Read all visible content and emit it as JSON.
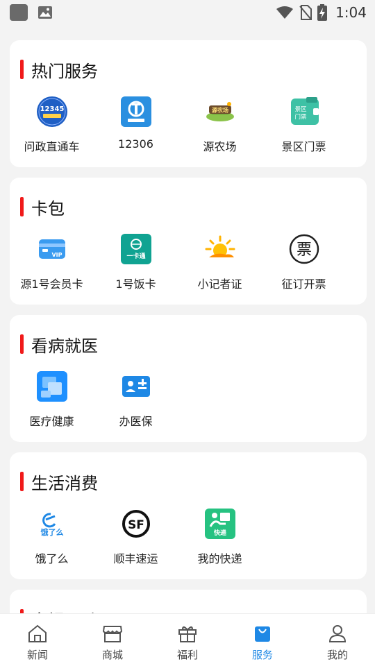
{
  "status_bar": {
    "time": "1:04"
  },
  "sections": [
    {
      "title": "热门服务",
      "items": [
        {
          "label": "问政直通车",
          "icon": "12345-hotline-icon",
          "badge": "12345"
        },
        {
          "label": "12306",
          "icon": "railway-12306-icon"
        },
        {
          "label": "源农场",
          "icon": "farm-icon",
          "badge": "源农场"
        },
        {
          "label": "景区门票",
          "icon": "scenic-ticket-icon",
          "badge": "景区门票"
        }
      ]
    },
    {
      "title": "卡包",
      "items": [
        {
          "label": "源1号会员卡",
          "icon": "vip-card-icon",
          "badge": "VIP"
        },
        {
          "label": "1号饭卡",
          "icon": "meal-card-icon",
          "badge": "一卡通"
        },
        {
          "label": "小记者证",
          "icon": "sun-icon"
        },
        {
          "label": "征订开票",
          "icon": "invoice-icon",
          "badge": "票"
        }
      ]
    },
    {
      "title": "看病就医",
      "items": [
        {
          "label": "医疗健康",
          "icon": "medical-health-icon"
        },
        {
          "label": "办医保",
          "icon": "medical-insurance-icon"
        }
      ]
    },
    {
      "title": "生活消费",
      "items": [
        {
          "label": "饿了么",
          "icon": "eleme-icon",
          "badge": "饿了么"
        },
        {
          "label": "顺丰速运",
          "icon": "sf-express-icon",
          "badge": "SF"
        },
        {
          "label": "我的快递",
          "icon": "delivery-icon",
          "badge": "快递"
        }
      ]
    },
    {
      "title": "文娱运动"
    }
  ],
  "bottom_nav": [
    {
      "label": "新闻",
      "icon": "home-icon"
    },
    {
      "label": "商城",
      "icon": "store-icon"
    },
    {
      "label": "福利",
      "icon": "gift-icon"
    },
    {
      "label": "服务",
      "icon": "bag-icon",
      "active": true
    },
    {
      "label": "我的",
      "icon": "user-icon"
    }
  ],
  "colors": {
    "accent": "#1e88e5",
    "title_bar": "#f01a1a"
  }
}
